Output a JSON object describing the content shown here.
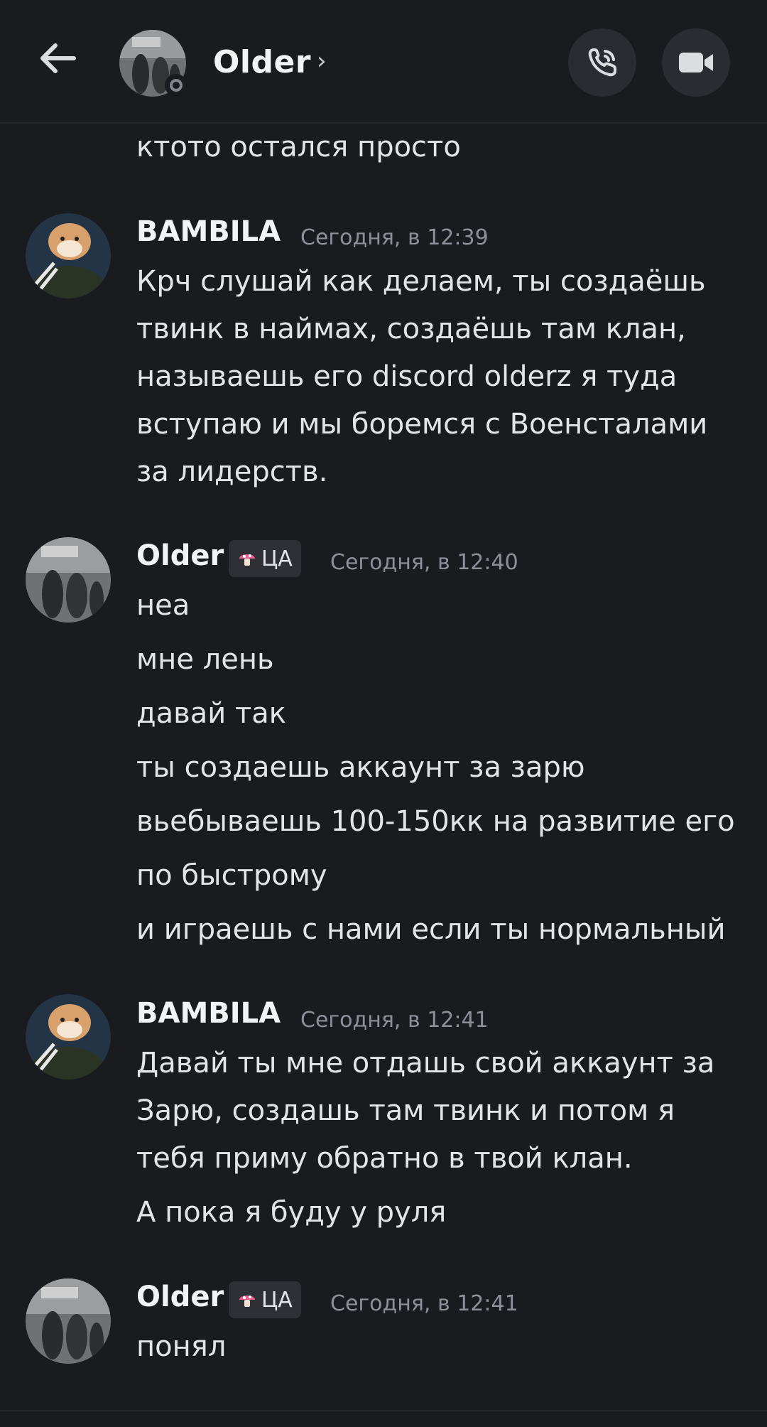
{
  "header": {
    "title": "Older",
    "chevron": "›",
    "back_icon": "arrow-left-icon",
    "call_icon": "phone-call-icon",
    "video_icon": "video-camera-icon"
  },
  "colors": {
    "background": "#1a1b1f",
    "text": "#e3e4e8",
    "muted": "#8e9099",
    "button_bg": "#2b2c32"
  },
  "messages": {
    "m0": {
      "lines": [
        "ктото остался просто"
      ]
    },
    "m1": {
      "author": "BAMBILA",
      "time": "Сегодня, в 12:39",
      "lines": [
        "Крч слушай как делаем, ты создаёшь",
        "твинк в наймах, создаёшь там клан,",
        "называешь его discord olderz я туда",
        "вступаю и мы боремся с Военсталами",
        "за лидерств."
      ]
    },
    "m2": {
      "author": "Older",
      "tag": "ЦА",
      "time": "Сегодня, в 12:40",
      "lines": [
        "неа",
        "мне лень",
        "давай так",
        "ты создаешь аккаунт за зарю",
        "вьебываешь 100-150кк на развитие его",
        "по быстрому",
        "и играешь с нами если ты нормальный"
      ]
    },
    "m3": {
      "author": "BAMBILA",
      "time": "Сегодня, в 12:41",
      "lines": [
        "Давай ты мне отдашь свой аккаунт за",
        "Зарю, создашь там твинк и потом я",
        "тебя приму обратно в твой клан.",
        "А пока я буду у руля"
      ]
    },
    "m4": {
      "author": "Older",
      "tag": "ЦА",
      "time": "Сегодня, в 12:41",
      "lines": [
        "понял"
      ]
    }
  }
}
